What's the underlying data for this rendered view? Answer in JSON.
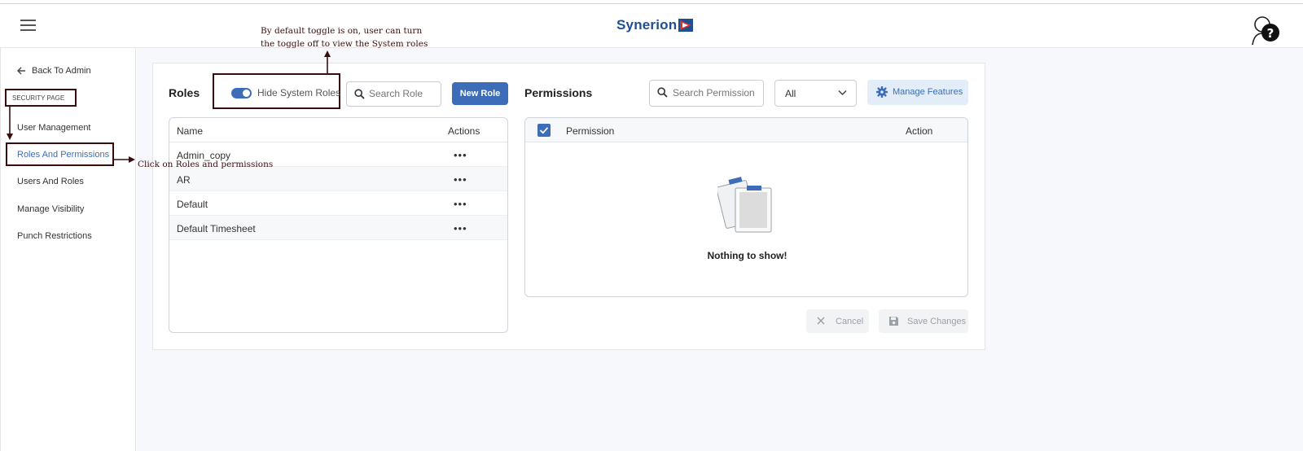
{
  "header": {
    "logo_text": "Synerion",
    "brand_color": "#1d4f91",
    "menu_icon": "hamburger-icon",
    "help_icon": "help-icon"
  },
  "sidebar": {
    "back_label": "Back To Admin",
    "section_label": "SECURITY PAGE",
    "items": [
      {
        "label": "User Management",
        "active": false
      },
      {
        "label": "Roles And Permissions",
        "active": true
      },
      {
        "label": "Users And Roles",
        "active": false
      },
      {
        "label": "Manage Visibility",
        "active": false
      },
      {
        "label": "Punch Restrictions",
        "active": false
      }
    ]
  },
  "roles": {
    "title": "Roles",
    "toggle_label": "Hide System Roles",
    "toggle_on": true,
    "search_placeholder": "Search Role",
    "new_role_label": "New Role",
    "columns": {
      "name": "Name",
      "actions": "Actions"
    },
    "rows": [
      {
        "name": "Admin_copy"
      },
      {
        "name": "AR"
      },
      {
        "name": "Default"
      },
      {
        "name": "Default Timesheet"
      }
    ],
    "row_action_icon": "more-horizontal-icon"
  },
  "permissions": {
    "title": "Permissions",
    "search_placeholder": "Search Permission",
    "filter_value": "All",
    "manage_label": "Manage Features",
    "columns": {
      "permission": "Permission",
      "action": "Action"
    },
    "empty_text": "Nothing to show!",
    "cancel_label": "Cancel",
    "save_label": "Save Changes"
  },
  "annotations": {
    "toggle_note_line1": "By default toggle is on, user can turn",
    "toggle_note_line2": "the toggle off to view the System roles",
    "click_note": "Click on Roles and permissions"
  },
  "colors": {
    "accent": "#3d6cb9",
    "annotation": "#3a0d0d",
    "background": "#f6f8fb"
  }
}
